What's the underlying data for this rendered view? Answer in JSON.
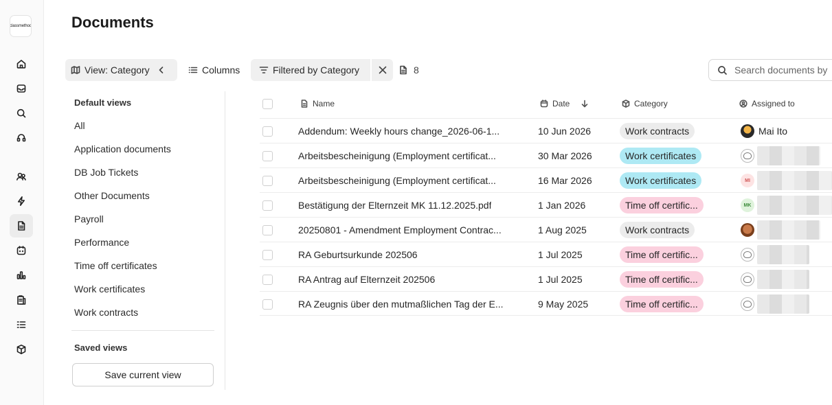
{
  "app": {
    "logo_text": "classmethod",
    "page_title": "Documents"
  },
  "rail": {
    "icons": [
      "home-icon",
      "inbox-icon",
      "search-icon",
      "headset-icon",
      "people-icon",
      "lightning-icon",
      "document-icon",
      "calendar-icon",
      "chart-icon",
      "clipboard-icon",
      "checklist-icon",
      "cube-icon"
    ],
    "active": "document-icon"
  },
  "toolbar": {
    "view_label": "View: Category",
    "columns_label": "Columns",
    "filter_label": "Filtered by Category",
    "doc_count": "8"
  },
  "search": {
    "placeholder": "Search documents by"
  },
  "views_panel": {
    "default_heading": "Default views",
    "items": [
      "All",
      "Application documents",
      "DB Job Tickets",
      "Other Documents",
      "Payroll",
      "Performance",
      "Time off certificates",
      "Work certificates",
      "Work contracts"
    ],
    "saved_heading": "Saved views",
    "save_button": "Save current view"
  },
  "table": {
    "columns": {
      "name": "Name",
      "date": "Date",
      "category": "Category",
      "assigned": "Assigned to"
    },
    "sort": {
      "column": "Date",
      "direction": "descending"
    },
    "category_colors": {
      "Work contracts": "#ececec",
      "Work certificates": "#aee9f4",
      "Time off certific...": "#fbd0de"
    },
    "rows": [
      {
        "name": "Addendum: Weekly hours change_2026-06-1...",
        "date": "10 Jun 2026",
        "category": "Work contracts",
        "avatar": "photo",
        "avatar_text": "",
        "assignee": "Mai Ito"
      },
      {
        "name": "Arbeitsbescheinigung (Employment certificat...",
        "date": "30 Mar 2026",
        "category": "Work certificates",
        "avatar": "sketch",
        "avatar_text": "",
        "assignee": ""
      },
      {
        "name": "Arbeitsbescheinigung (Employment certificat...",
        "date": "16 Mar 2026",
        "category": "Work certificates",
        "avatar": "mi",
        "avatar_text": "MI",
        "assignee": ""
      },
      {
        "name": "Bestätigung der Elternzeit MK 11.12.2025.pdf",
        "date": "1 Jan 2026",
        "category": "Time off certific...",
        "avatar": "mk",
        "avatar_text": "MK",
        "assignee": ""
      },
      {
        "name": "20250801 - Amendment Employment Contrac...",
        "date": "1 Aug 2025",
        "category": "Work contracts",
        "avatar": "brown",
        "avatar_text": "",
        "assignee": ""
      },
      {
        "name": "RA Geburtsurkunde 202506",
        "date": "1 Jul 2025",
        "category": "Time off certific...",
        "avatar": "sketch",
        "avatar_text": "",
        "assignee": ""
      },
      {
        "name": "RA Antrag auf Elternzeit 202506",
        "date": "1 Jul 2025",
        "category": "Time off certific...",
        "avatar": "sketch",
        "avatar_text": "",
        "assignee": ""
      },
      {
        "name": "RA Zeugnis über den mutmaßlichen Tag der E...",
        "date": "9 May 2025",
        "category": "Time off certific...",
        "avatar": "sketch",
        "avatar_text": "",
        "assignee": ""
      }
    ]
  }
}
